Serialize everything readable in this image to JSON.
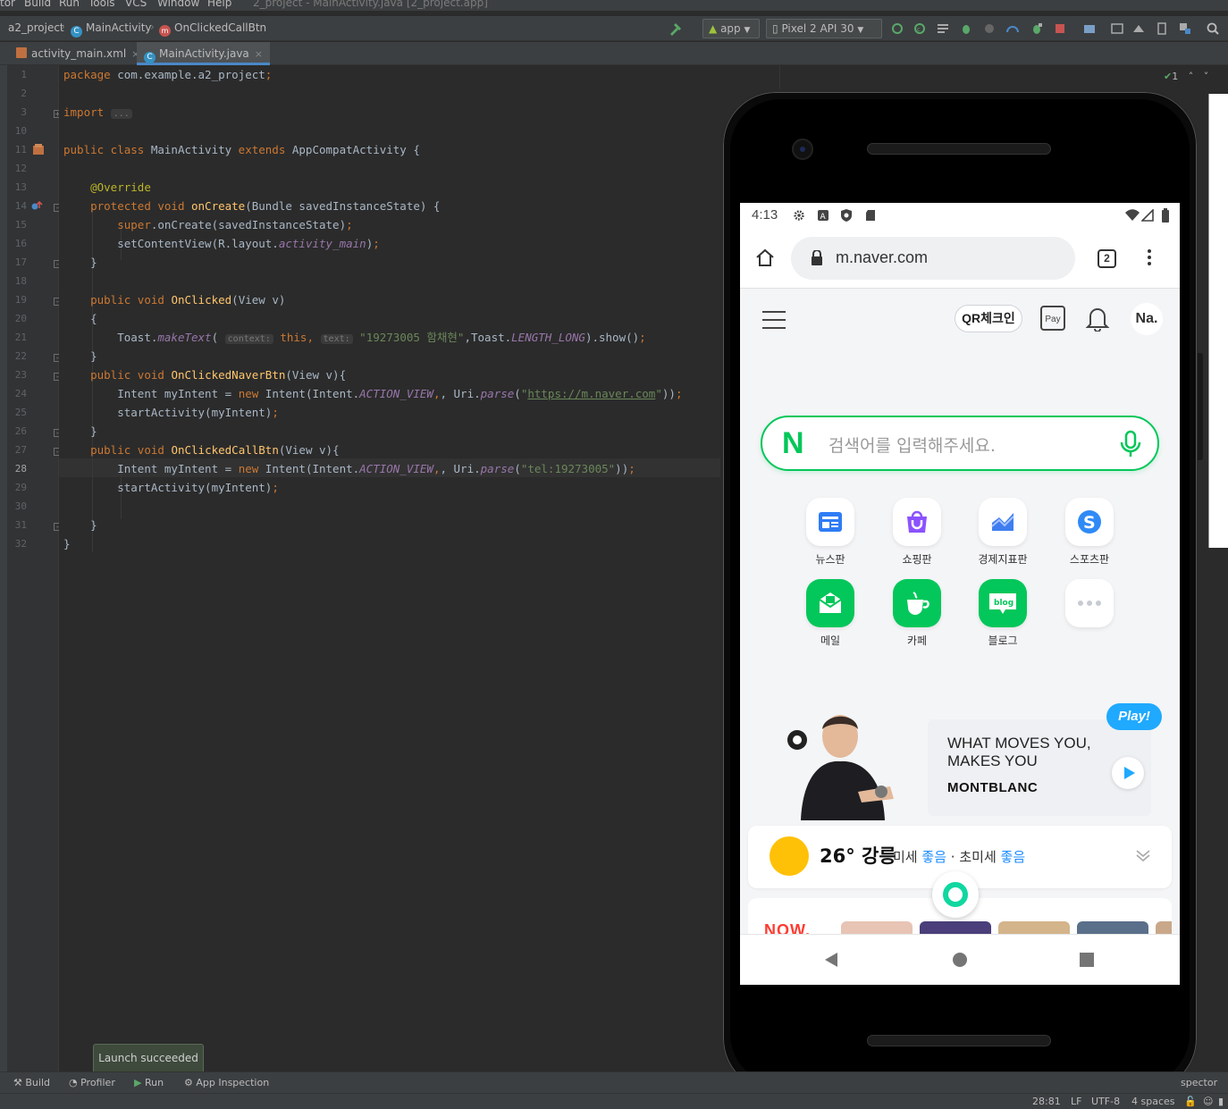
{
  "ide": {
    "menu": [
      "tor",
      "Build",
      "Run",
      "Tools",
      "VCS",
      "Window",
      "Help"
    ],
    "window_title": "2_project - MainActivity.java [2_project.app]",
    "breadcrumb": [
      "a2_project",
      "MainActivity",
      "OnClickedCallBtn"
    ],
    "run_config": "app",
    "device": "Pixel 2 API 30",
    "tabs": [
      "activity_main.xml",
      "MainActivity.java"
    ],
    "inspection_count": "1",
    "line_numbers": [
      "1",
      "2",
      "3",
      "10",
      "11",
      "12",
      "13",
      "14",
      "15",
      "16",
      "17",
      "18",
      "19",
      "20",
      "21",
      "22",
      "23",
      "24",
      "25",
      "26",
      "27",
      "28",
      "29",
      "30",
      "31",
      "32"
    ],
    "code": {
      "l1_kw": "package",
      "l1_rest": " com.example.a2_project",
      "l1_semi": ";",
      "l3_kw": "import",
      "l3_fold": "...",
      "l11_a": "public class",
      "l11_b": " MainActivity ",
      "l11_c": "extends",
      "l11_d": " AppCompatActivity {",
      "l13": "@Override",
      "l14_kw": "protected void",
      "l14_fn": "onCreate",
      "l14_rest": "(Bundle savedInstanceState) {",
      "l15_kw": "super",
      "l15_rest": ".onCreate(savedInstanceState)",
      "l15_semi": ";",
      "l16_a": "setContentView(R.layout.",
      "l16_it": "activity_main",
      "l16_b": ")",
      "l16_semi": ";",
      "brace_close": "}",
      "brace_open": "{",
      "l19_kw": "public void",
      "l19_fn": "OnClicked",
      "l19_rest": "(View v)",
      "l21_a": "Toast.",
      "l21_it": "makeText",
      "l21_b": "(",
      "l21_hint1": "context:",
      "l21_this": "this,",
      "l21_hint2": "text:",
      "l21_str": "\"19273005 함채현\"",
      "l21_c": ",Toast.",
      "l21_it2": "LENGTH_LONG",
      "l21_d": ").show()",
      "l21_semi": ";",
      "l23_kw": "public void",
      "l23_fn": "OnClickedNaverBtn",
      "l23_rest": "(View v){",
      "l24_a": "Intent myIntent = ",
      "l24_kw": "new",
      "l24_b": " Intent(Intent.",
      "l24_it": "ACTION_VIEW",
      "l24_c": ", Uri.",
      "l24_it2": "parse",
      "l24_d": "(",
      "l24_q1": "\"",
      "l24_url": "https://m.naver.com",
      "l24_q2": "\"",
      "l24_e": "))",
      "l24_semi": ";",
      "l25": "startActivity(myIntent)",
      "l25_semi": ";",
      "l27_kw": "public void",
      "l27_fn": "OnClickedCallBtn",
      "l27_rest": "(View v){",
      "l28_str": "\"tel:19273005\""
    },
    "launch_toast": "Launch succeeded",
    "tool_windows": [
      "Build",
      "Profiler",
      "Run",
      "App Inspection"
    ],
    "inspector_label": "spector",
    "status": {
      "position": "28:81",
      "line_sep": "LF",
      "encoding": "UTF-8",
      "indent": "4 spaces"
    }
  },
  "phone": {
    "time": "4:13",
    "url": "m.naver.com",
    "tab_count": "2",
    "header": {
      "qr": "QR체크인",
      "pay": "Pay",
      "profile": "Na."
    },
    "search_placeholder": "검색어를 입력해주세요.",
    "search_logo": "N",
    "services": [
      {
        "label": "뉴스판"
      },
      {
        "label": "쇼핑판"
      },
      {
        "label": "경제지표판"
      },
      {
        "label": "스포츠판"
      },
      {
        "label": "메일"
      },
      {
        "label": "카페"
      },
      {
        "label": "블로그"
      },
      {
        "label": ""
      }
    ],
    "ad": {
      "badge": "Play!",
      "headline_1": "WHAT MOVES YOU,",
      "headline_2": "MAKES YOU",
      "brand": "MONTBLANC"
    },
    "weather": {
      "temp": "26° 강릉",
      "dust_1": "미세",
      "dust_1_val": "좋음",
      "sep": "·",
      "dust_2": "초미세",
      "dust_2_val": "좋음"
    },
    "now_label": "NOW."
  }
}
